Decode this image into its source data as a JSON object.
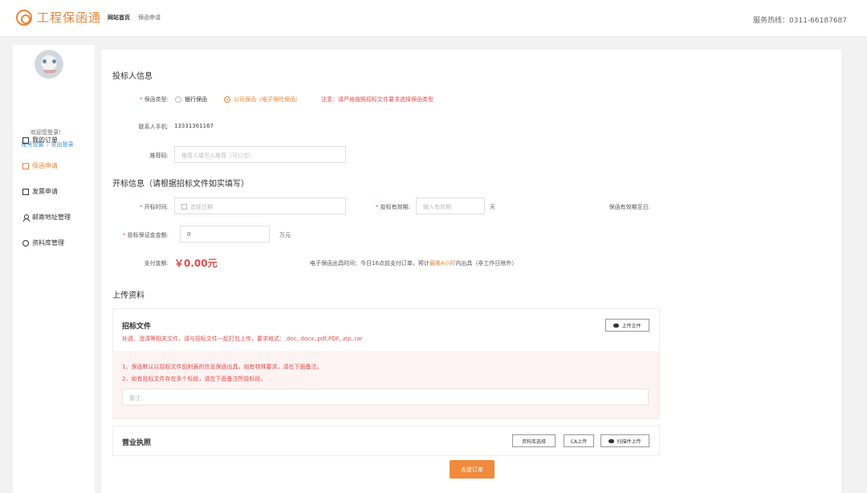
{
  "header": {
    "logo_text": "工程保函通",
    "nav": [
      "网站首页",
      "保函申请"
    ],
    "hotline": "服务热线：0311-66187687"
  },
  "sidebar": {
    "welcome": "欢迎您登录！",
    "links": [
      "账号设置",
      "退出登录"
    ],
    "menu": [
      {
        "label": "我的订单"
      },
      {
        "label": "保函申请"
      },
      {
        "label": "发票申请"
      },
      {
        "label": "邮寄地址管理"
      },
      {
        "label": "资料库管理"
      }
    ]
  },
  "bidder": {
    "title": "投标人信息",
    "guarantee_type_label": "保函类型:",
    "options": [
      "银行保函",
      "公司保函（电子保险保函）"
    ],
    "warning": "注意：请严格按照招标文件要求选择保函类型",
    "phone_label": "联系人手机:",
    "phone": "13331361167",
    "recommender_label": "推荐码:",
    "recommender_placeholder": "推荐人填写人推荐（可以空）"
  },
  "opening": {
    "title": "开标信息（请根据招标文件如实填写）",
    "time_label": "开标时间:",
    "time_placeholder": "选择日期",
    "validity_label": "投标有效期:",
    "validity_placeholder": "输入有效期",
    "validity_unit": "天",
    "deadline_label": "保函有效期至日:",
    "deposit_label": "投标保证金金额:",
    "deposit_value": "0",
    "deposit_unit": "万元",
    "pay_label": "支付金额:",
    "pay_amount": "￥0.00元",
    "note_prefix": "电子保函出具时间：今日16点前支付订单，预计",
    "note_highlight": "最晚4小时",
    "note_suffix": "内出具（非工作日除外）"
  },
  "upload": {
    "title": "上传资料",
    "bid_file_title": "招标文件",
    "bid_file_desc": "补遗、澄清等相关文件，请与招标文件一起打包上传，要求格式：.doc,.docx,.pdf,PDF,.zip,.rar",
    "upload_button": "上传文件",
    "warnings": [
      "1、保函默认以招标文件前附表的信息保函出具，如有特殊要求，请在下面备注。",
      "2、如有投标文件存在多个标段，请在下面备注所投标段。"
    ],
    "remark_placeholder": "备注：",
    "license_title": "营业执照",
    "license_buttons": [
      "资料库选择",
      "CA上传",
      "扫描件上传"
    ]
  },
  "submit_label": "去提订单"
}
